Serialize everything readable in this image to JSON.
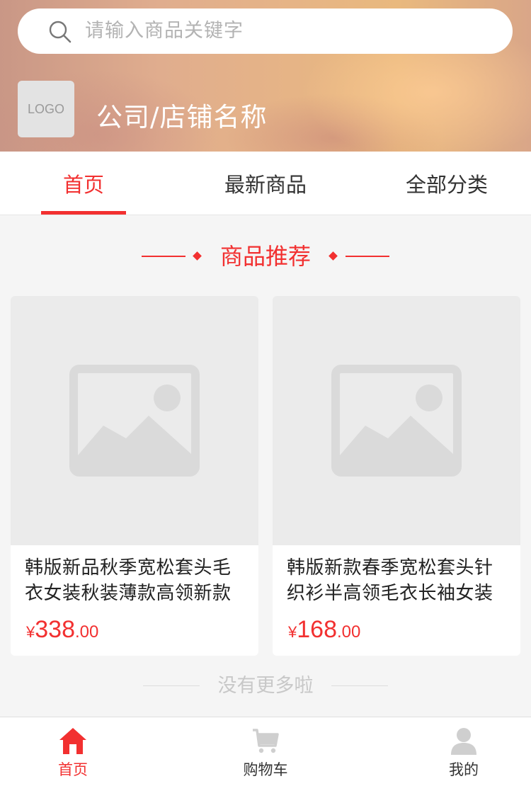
{
  "search": {
    "placeholder": "请输入商品关键字"
  },
  "shop": {
    "logo_text": "LOGO",
    "name": "公司/店铺名称"
  },
  "tabs": [
    {
      "label": "首页",
      "active": true
    },
    {
      "label": "最新商品",
      "active": false
    },
    {
      "label": "全部分类",
      "active": false
    }
  ],
  "section": {
    "title": "商品推荐"
  },
  "products": [
    {
      "title": "韩版新品秋季宽松套头毛衣女装秋装薄款高领新款",
      "currency": "¥",
      "price_int": "338",
      "price_dec": ".00",
      "image_icon": "image-placeholder-icon"
    },
    {
      "title": "韩版新款春季宽松套头针织衫半高领毛衣长袖女装",
      "currency": "¥",
      "price_int": "168",
      "price_dec": ".00",
      "image_icon": "image-placeholder-icon"
    }
  ],
  "footer": {
    "no_more": "没有更多啦"
  },
  "bottom_nav": [
    {
      "label": "首页",
      "icon": "home-icon",
      "active": true
    },
    {
      "label": "购物车",
      "icon": "cart-icon",
      "active": false
    },
    {
      "label": "我的",
      "icon": "user-icon",
      "active": false
    }
  ],
  "colors": {
    "accent": "#f23030",
    "background": "#f5f5f5"
  }
}
